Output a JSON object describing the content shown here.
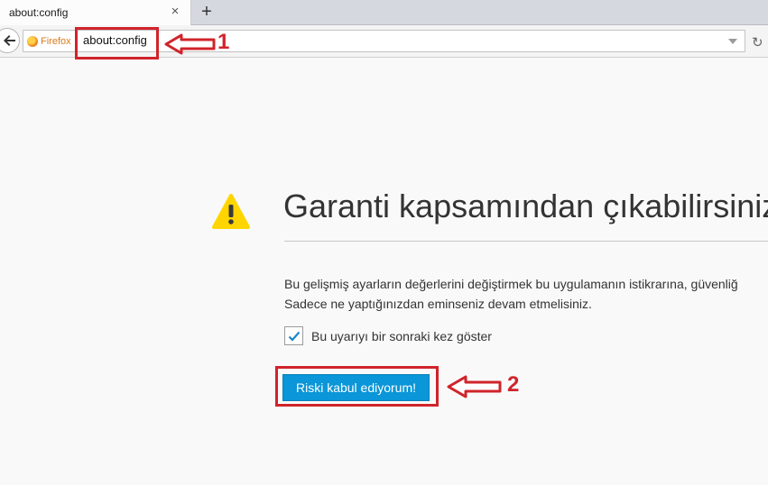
{
  "tab": {
    "title": "about:config",
    "close_glyph": "×",
    "new_tab_glyph": "+"
  },
  "navbar": {
    "identity_label": "Firefox",
    "url": "about:config",
    "reload_glyph": "↻"
  },
  "annotations": {
    "step1": "1",
    "step2": "2",
    "color": "#d0242b"
  },
  "warning": {
    "title": "Garanti kapsamından çıkabilirsiniz!",
    "line1": "Bu gelişmiş ayarların değerlerini değiştirmek bu uygulamanın istikrarına, güvenliğ",
    "line2": "Sadece ne yaptığınızdan eminseniz devam etmelisiniz.",
    "checkbox_label": "Bu uyarıyı bir sonraki kez göster",
    "checkbox_checked": true,
    "accept_button": "Riski kabul ediyorum!"
  },
  "colors": {
    "accent": "#0a96d8",
    "warning": "#ffd500"
  }
}
